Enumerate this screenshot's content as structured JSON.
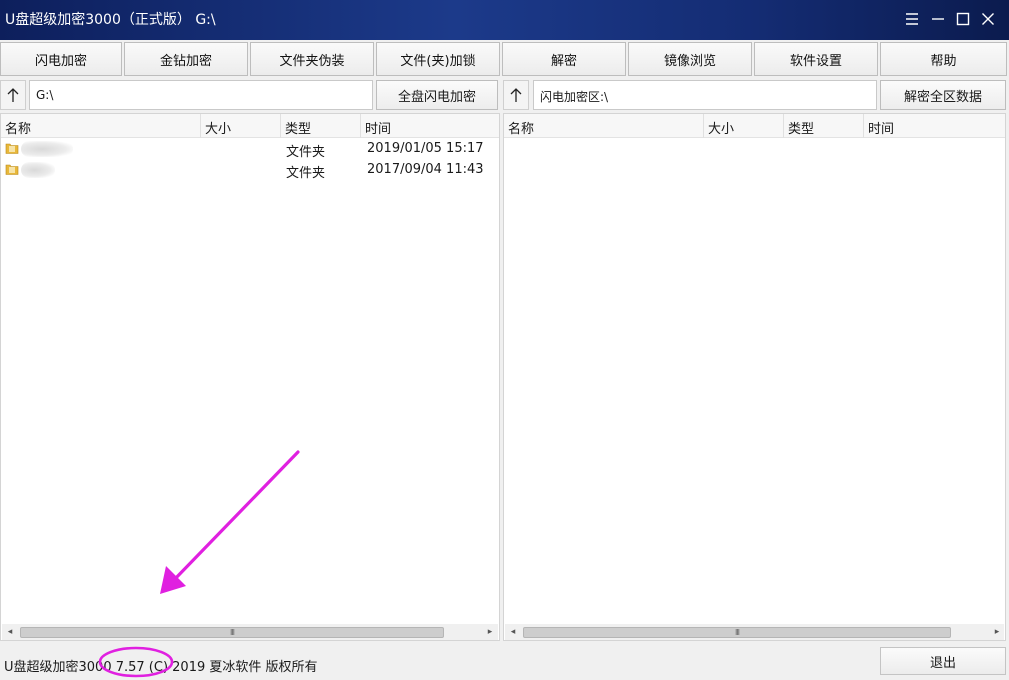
{
  "window": {
    "title": "U盘超级加密3000（正式版） G:\\",
    "controls": [
      "menu-icon",
      "minimize-icon",
      "maximize-icon",
      "close-icon"
    ]
  },
  "toolbar": {
    "items": [
      "闪电加密",
      "金钻加密",
      "文件夹伪装",
      "文件(夹)加锁",
      "解密",
      "镜像浏览",
      "软件设置",
      "帮助"
    ]
  },
  "left_pane": {
    "path": "G:\\",
    "action_label": "全盘闪电加密",
    "columns": [
      "名称",
      "大小",
      "类型",
      "时间"
    ],
    "rows": [
      {
        "type": "文件夹",
        "time": "2019/01/05 15:17"
      },
      {
        "type": "文件夹",
        "time": "2017/09/04 11:43"
      }
    ]
  },
  "right_pane": {
    "path": "闪电加密区:\\",
    "action_label": "解密全区数据",
    "columns": [
      "名称",
      "大小",
      "类型",
      "时间"
    ],
    "rows": []
  },
  "scroll_thumb_glyph": "III",
  "status": {
    "text": "U盘超级加密3000 7.57 (C) 2019 夏冰软件 版权所有"
  },
  "exit_label": "退出",
  "colors": {
    "titlebar": "#1c3a8a",
    "annotation": "#e020e0",
    "folder": "#e8b83a"
  }
}
